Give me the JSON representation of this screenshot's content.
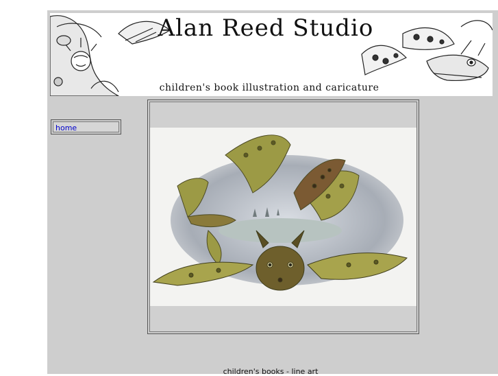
{
  "header": {
    "title": "Alan Reed Studio",
    "subtitle": "children's book illustration and caricature"
  },
  "nav": {
    "items": [
      {
        "label": "home"
      }
    ]
  },
  "main": {
    "caption": "children's books - line art"
  },
  "colors": {
    "page_background": "#cecece",
    "link": "#0000cc",
    "frame_border": "#555555"
  },
  "icons": [
    "banner-dragon-illustration",
    "caricature-figure-illustration",
    "flying-dragons-artwork"
  ]
}
